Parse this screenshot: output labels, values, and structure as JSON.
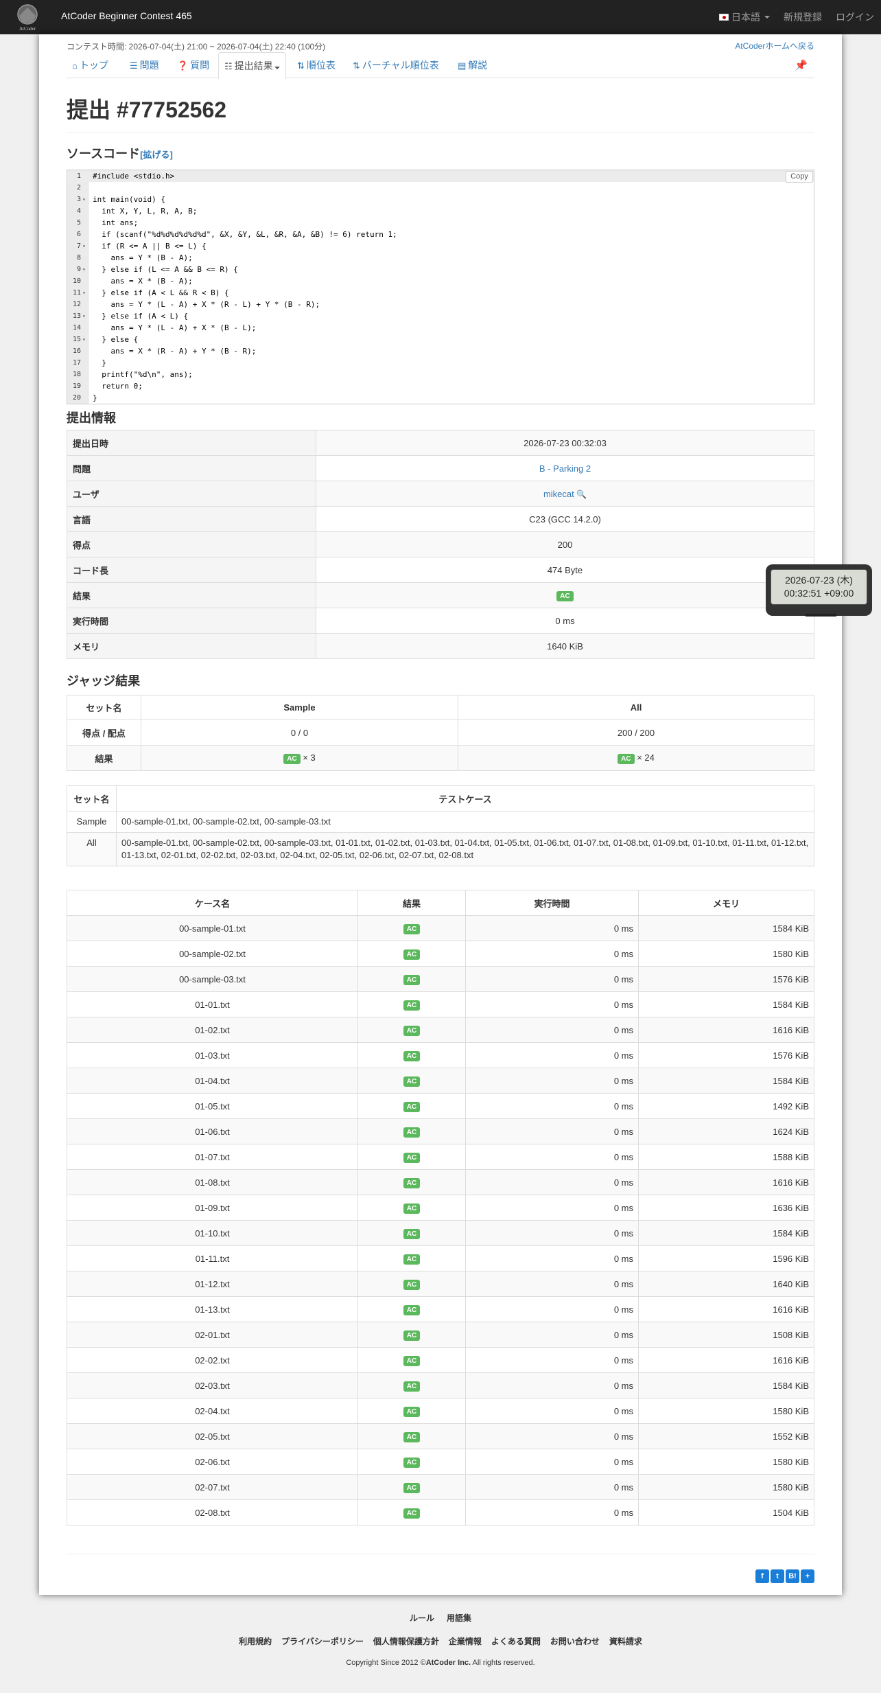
{
  "navbar": {
    "brand": "AtCoder Beginner Contest 465",
    "logo_text": "AtCoder",
    "language": "日本語",
    "signup": "新規登録",
    "login": "ログイン"
  },
  "contest_time": "コンテスト時間: 2026-07-04(土) 21:00 ~ 2026-07-04(土) 22:40 (100分)",
  "home_link": "AtCoderホームへ戻る",
  "tabs": [
    {
      "label": "トップ"
    },
    {
      "label": "問題"
    },
    {
      "label": "質問"
    },
    {
      "label": "提出結果"
    },
    {
      "label": "順位表"
    },
    {
      "label": "バーチャル順位表"
    },
    {
      "label": "解説"
    }
  ],
  "title": "提出 #77752562",
  "source": {
    "heading": "ソースコード",
    "expand": "[拡げる]",
    "copy": "Copy",
    "lines": [
      "#include <stdio.h>",
      "",
      "int main(void) {",
      "  int X, Y, L, R, A, B;",
      "  int ans;",
      "  if (scanf(\"%d%d%d%d%d%d\", &X, &Y, &L, &R, &A, &B) != 6) return 1;",
      "  if (R <= A || B <= L) {",
      "    ans = Y * (B - A);",
      "  } else if (L <= A && B <= R) {",
      "    ans = X * (B - A);",
      "  } else if (A < L && R < B) {",
      "    ans = Y * (L - A) + X * (R - L) + Y * (B - R);",
      "  } else if (A < L) {",
      "    ans = Y * (L - A) + X * (B - L);",
      "  } else {",
      "    ans = X * (R - A) + Y * (B - R);",
      "  }",
      "  printf(\"%d\\n\", ans);",
      "  return 0;",
      "}"
    ]
  },
  "info": {
    "heading": "提出情報",
    "rows": [
      {
        "label": "提出日時",
        "value": "2026-07-23 00:32:03"
      },
      {
        "label": "問題",
        "value": "B - Parking 2"
      },
      {
        "label": "ユーザ",
        "value": "mikecat"
      },
      {
        "label": "言語",
        "value": "C23 (GCC 14.2.0)"
      },
      {
        "label": "得点",
        "value": "200"
      },
      {
        "label": "コード長",
        "value": "474 Byte"
      },
      {
        "label": "結果",
        "value": "AC"
      },
      {
        "label": "実行時間",
        "value": "0 ms"
      },
      {
        "label": "メモリ",
        "value": "1640 KiB"
      }
    ]
  },
  "judge": {
    "heading": "ジャッジ結果",
    "col_set": "セット名",
    "col_sample": "Sample",
    "col_all": "All",
    "score_label": "得点 / 配点",
    "score_sample": "0 / 0",
    "score_all": "200 / 200",
    "result_label": "結果",
    "result_sample_badge": "AC",
    "result_sample_count": "× 3",
    "result_all_badge": "AC",
    "result_all_count": "× 24"
  },
  "sets": {
    "col_set": "セット名",
    "col_cases": "テストケース",
    "rows": [
      {
        "name": "Sample",
        "cases": "00-sample-01.txt, 00-sample-02.txt, 00-sample-03.txt"
      },
      {
        "name": "All",
        "cases": "00-sample-01.txt, 00-sample-02.txt, 00-sample-03.txt, 01-01.txt, 01-02.txt, 01-03.txt, 01-04.txt, 01-05.txt, 01-06.txt, 01-07.txt, 01-08.txt, 01-09.txt, 01-10.txt, 01-11.txt, 01-12.txt, 01-13.txt, 02-01.txt, 02-02.txt, 02-03.txt, 02-04.txt, 02-05.txt, 02-06.txt, 02-07.txt, 02-08.txt"
      }
    ]
  },
  "cases": {
    "headers": [
      "ケース名",
      "結果",
      "実行時間",
      "メモリ"
    ],
    "rows": [
      {
        "name": "00-sample-01.txt",
        "result": "AC",
        "time": "0 ms",
        "memory": "1584 KiB"
      },
      {
        "name": "00-sample-02.txt",
        "result": "AC",
        "time": "0 ms",
        "memory": "1580 KiB"
      },
      {
        "name": "00-sample-03.txt",
        "result": "AC",
        "time": "0 ms",
        "memory": "1576 KiB"
      },
      {
        "name": "01-01.txt",
        "result": "AC",
        "time": "0 ms",
        "memory": "1584 KiB"
      },
      {
        "name": "01-02.txt",
        "result": "AC",
        "time": "0 ms",
        "memory": "1616 KiB"
      },
      {
        "name": "01-03.txt",
        "result": "AC",
        "time": "0 ms",
        "memory": "1576 KiB"
      },
      {
        "name": "01-04.txt",
        "result": "AC",
        "time": "0 ms",
        "memory": "1584 KiB"
      },
      {
        "name": "01-05.txt",
        "result": "AC",
        "time": "0 ms",
        "memory": "1492 KiB"
      },
      {
        "name": "01-06.txt",
        "result": "AC",
        "time": "0 ms",
        "memory": "1624 KiB"
      },
      {
        "name": "01-07.txt",
        "result": "AC",
        "time": "0 ms",
        "memory": "1588 KiB"
      },
      {
        "name": "01-08.txt",
        "result": "AC",
        "time": "0 ms",
        "memory": "1616 KiB"
      },
      {
        "name": "01-09.txt",
        "result": "AC",
        "time": "0 ms",
        "memory": "1636 KiB"
      },
      {
        "name": "01-10.txt",
        "result": "AC",
        "time": "0 ms",
        "memory": "1584 KiB"
      },
      {
        "name": "01-11.txt",
        "result": "AC",
        "time": "0 ms",
        "memory": "1596 KiB"
      },
      {
        "name": "01-12.txt",
        "result": "AC",
        "time": "0 ms",
        "memory": "1640 KiB"
      },
      {
        "name": "01-13.txt",
        "result": "AC",
        "time": "0 ms",
        "memory": "1616 KiB"
      },
      {
        "name": "02-01.txt",
        "result": "AC",
        "time": "0 ms",
        "memory": "1508 KiB"
      },
      {
        "name": "02-02.txt",
        "result": "AC",
        "time": "0 ms",
        "memory": "1616 KiB"
      },
      {
        "name": "02-03.txt",
        "result": "AC",
        "time": "0 ms",
        "memory": "1584 KiB"
      },
      {
        "name": "02-04.txt",
        "result": "AC",
        "time": "0 ms",
        "memory": "1580 KiB"
      },
      {
        "name": "02-05.txt",
        "result": "AC",
        "time": "0 ms",
        "memory": "1552 KiB"
      },
      {
        "name": "02-06.txt",
        "result": "AC",
        "time": "0 ms",
        "memory": "1580 KiB"
      },
      {
        "name": "02-07.txt",
        "result": "AC",
        "time": "0 ms",
        "memory": "1580 KiB"
      },
      {
        "name": "02-08.txt",
        "result": "AC",
        "time": "0 ms",
        "memory": "1504 KiB"
      }
    ]
  },
  "share": [
    "f",
    "t",
    "B!",
    "+"
  ],
  "tooltip": {
    "line1": "2026-07-23 (木)",
    "line2": "00:32:51 +09:00"
  },
  "footer": {
    "links1": [
      "ルール",
      "用語集"
    ],
    "links2": [
      "利用規約",
      "プライバシーポリシー",
      "個人情報保護方針",
      "企業情報",
      "よくある質問",
      "お問い合わせ",
      "資料請求"
    ],
    "copyright_prefix": "Copyright Since 2012 ©",
    "copyright_company": "AtCoder Inc.",
    "copyright_suffix": " All rights reserved."
  },
  "colors": {
    "ac_badge": "#5cb85c",
    "navbar": "#222222",
    "link": "#337ab7"
  }
}
